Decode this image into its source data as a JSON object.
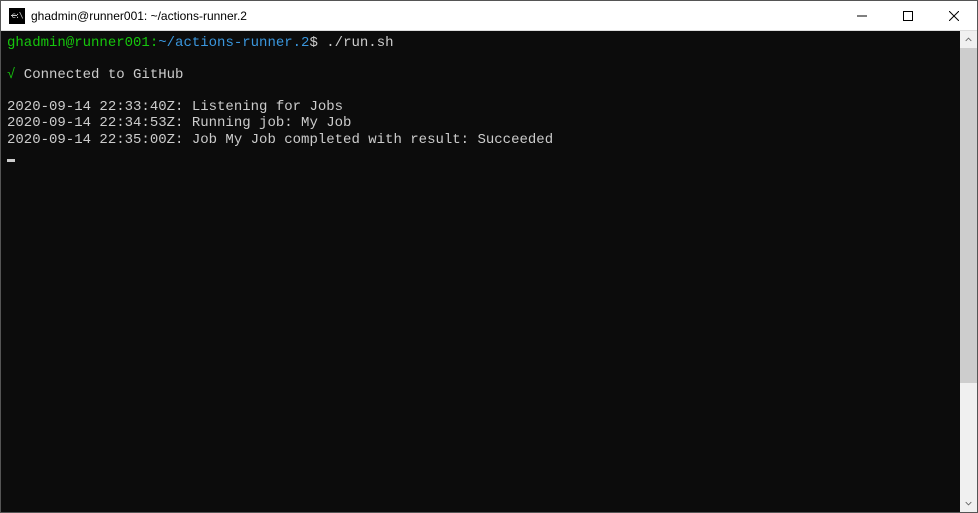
{
  "titlebar": {
    "title": "ghadmin@runner001: ~/actions-runner.2"
  },
  "terminal": {
    "prompt": {
      "user_host": "ghadmin@runner001",
      "colon": ":",
      "path": "~/actions-runner.2",
      "symbol": "$"
    },
    "command": "./run.sh",
    "check": "√",
    "connected": " Connected to GitHub",
    "logs": [
      "2020-09-14 22:33:40Z: Listening for Jobs",
      "2020-09-14 22:34:53Z: Running job: My Job",
      "2020-09-14 22:35:00Z: Job My Job completed with result: Succeeded"
    ]
  }
}
